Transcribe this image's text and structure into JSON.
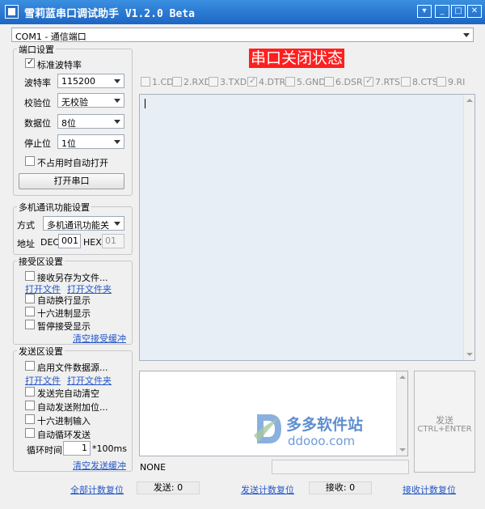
{
  "window": {
    "title": "雪莉蓝串口调试助手 V1.2.0 Beta",
    "controls": [
      "▾",
      "_",
      "□",
      "✕"
    ]
  },
  "port_select": {
    "value": "COM1 - 通信端口"
  },
  "port_settings": {
    "legend": "端口设置",
    "standard_baud_label": "标准波特率",
    "standard_baud_checked": true,
    "baud_label": "波特率",
    "baud_value": "115200",
    "parity_label": "校验位",
    "parity_value": "无校验",
    "databits_label": "数据位",
    "databits_value": "8位",
    "stopbits_label": "停止位",
    "stopbits_value": "1位",
    "auto_open_label": "不占用时自动打开",
    "auto_open_checked": false,
    "open_button": "打开串口"
  },
  "multi": {
    "legend": "多机通讯功能设置",
    "mode_label": "方式",
    "mode_value": "多机通讯功能关",
    "addr_label": "地址",
    "dec_label": "DEC",
    "dec_value": "001",
    "hex_label": "HEX",
    "hex_value": "01"
  },
  "recv_settings": {
    "legend": "接受区设置",
    "save_file_label": "接收另存为文件...",
    "open_file": "打开文件",
    "open_folder": "打开文件夹",
    "auto_newline_label": "自动换行显示",
    "hex_display_label": "十六进制显示",
    "pause_label": "暂停接受显示",
    "clear": "清空接受缓冲"
  },
  "send_settings": {
    "legend": "发送区设置",
    "file_source_label": "启用文件数据源...",
    "open_file": "打开文件",
    "open_folder": "打开文件夹",
    "auto_clear_label": "发送完自动清空",
    "append_label": "自动发送附加位...",
    "hex_input_label": "十六进制输入",
    "loop_label": "自动循环发送",
    "loop_time_label": "循环时间",
    "loop_time_value": "1",
    "loop_unit": "*100ms",
    "clear": "清空发送缓冲"
  },
  "status_banner": "串口关闭状态",
  "signals": [
    {
      "label": "1.CD",
      "checked": false
    },
    {
      "label": "2.RXD",
      "checked": false
    },
    {
      "label": "3.TXD",
      "checked": false
    },
    {
      "label": "4.DTR",
      "checked": true
    },
    {
      "label": "5.GND",
      "checked": false
    },
    {
      "label": "6.DSR",
      "checked": false
    },
    {
      "label": "7.RTS",
      "checked": true
    },
    {
      "label": "8.CTS",
      "checked": false
    },
    {
      "label": "9.RI",
      "checked": false
    }
  ],
  "send_button": {
    "line1": "发送",
    "line2": "CTRL+ENTER"
  },
  "status_line": {
    "text": "NONE"
  },
  "watermark": {
    "text1": "多多软件站",
    "text2": "ddooo.com"
  },
  "footer": {
    "reset_all": "全部计数复位",
    "sent_label": "发送: 0",
    "reset_sent": "发送计数复位",
    "recv_label": "接收: 0",
    "reset_recv": "接收计数复位"
  }
}
